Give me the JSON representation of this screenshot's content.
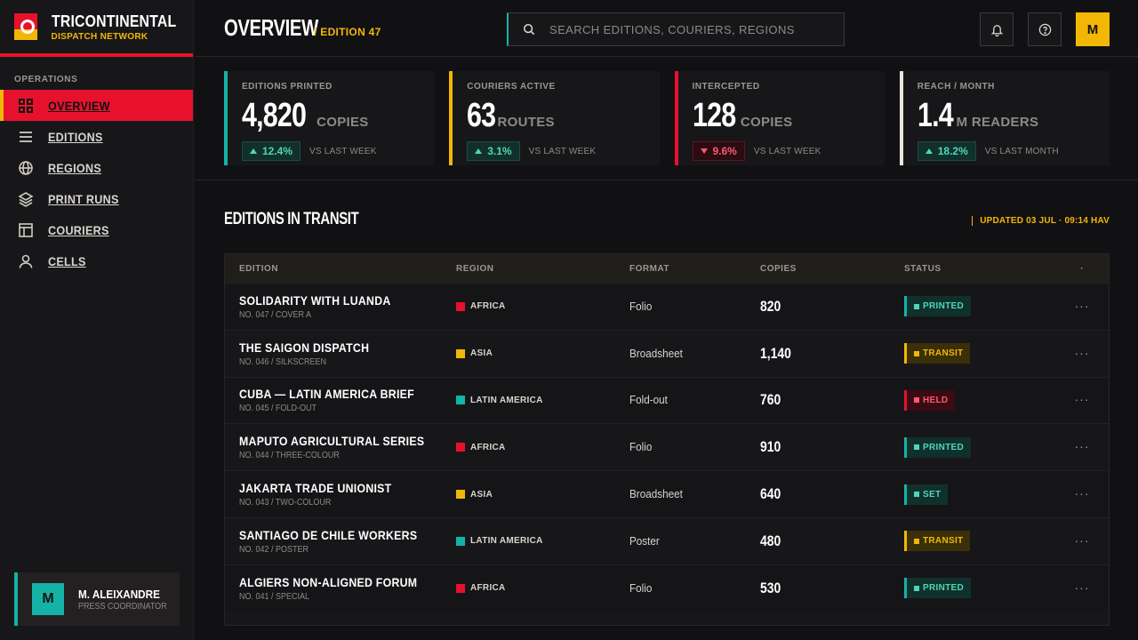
{
  "brand": {
    "title": "TRICONTINENTAL",
    "subtitle": "DISPATCH NETWORK"
  },
  "sidebar": {
    "section": "OPERATIONS",
    "items": [
      {
        "label": "Overview",
        "icon": "grid-icon"
      },
      {
        "label": "Editions",
        "icon": "list-icon"
      },
      {
        "label": "Regions",
        "icon": "globe-icon"
      },
      {
        "label": "Print Runs",
        "icon": "layers-icon"
      },
      {
        "label": "Couriers",
        "icon": "layout-icon"
      },
      {
        "label": "Cells",
        "icon": "user-icon"
      }
    ],
    "active_index": 0
  },
  "user": {
    "initial": "M",
    "name": "M. ALEIXANDRE",
    "role": "PRESS COORDINATOR"
  },
  "header": {
    "title": "OVERVIEW",
    "edition": "/ EDITION 47",
    "search_placeholder": "Search editions, couriers, regions",
    "avatar_initial": "M"
  },
  "kpis": [
    {
      "label": "Editions Printed",
      "value": "4,820",
      "unit": "copies",
      "delta": "12.4%",
      "direction": "up",
      "compare": "vs last week"
    },
    {
      "label": "Couriers Active",
      "value": "63",
      "unit": "routes",
      "delta": "3.1%",
      "direction": "up",
      "compare": "vs last week"
    },
    {
      "label": "Intercepted",
      "value": "128",
      "unit": "copies",
      "delta": "9.6%",
      "direction": "down",
      "compare": "vs last week"
    },
    {
      "label": "Reach / Month",
      "value": "1.4",
      "unit": "M readers",
      "delta": "18.2%",
      "direction": "up",
      "compare": "vs last month"
    }
  ],
  "section": {
    "title": "EDITIONS IN TRANSIT",
    "updated": "UPDATED 03 JUL · 09:14 HAV"
  },
  "table": {
    "columns": [
      "Edition",
      "Region",
      "Format",
      "Copies",
      "Status",
      "·"
    ],
    "rows": [
      {
        "title": "Solidarity with Luanda",
        "sub": "No. 047 / Cover A",
        "region": "Africa",
        "region_color": "#e8112d",
        "format": "Folio",
        "copies": "820",
        "status": "Printed",
        "status_kind": "printed"
      },
      {
        "title": "The Saigon Dispatch",
        "sub": "No. 046 / Silkscreen",
        "region": "Asia",
        "region_color": "#f2b705",
        "format": "Broadsheet",
        "copies": "1,140",
        "status": "Transit",
        "status_kind": "transit"
      },
      {
        "title": "Cuba — Latin America Brief",
        "sub": "No. 045 / Fold-out",
        "region": "Latin America",
        "region_color": "#15b2a8",
        "format": "Fold-out",
        "copies": "760",
        "status": "Held",
        "status_kind": "held"
      },
      {
        "title": "Maputo Agricultural Series",
        "sub": "No. 044 / Three-colour",
        "region": "Africa",
        "region_color": "#e8112d",
        "format": "Folio",
        "copies": "910",
        "status": "Printed",
        "status_kind": "printed"
      },
      {
        "title": "Jakarta Trade Unionist",
        "sub": "No. 043 / Two-colour",
        "region": "Asia",
        "region_color": "#f2b705",
        "format": "Broadsheet",
        "copies": "640",
        "status": "Set",
        "status_kind": "set"
      },
      {
        "title": "Santiago de Chile Workers",
        "sub": "No. 042 / Poster",
        "region": "Latin America",
        "region_color": "#15b2a8",
        "format": "Poster",
        "copies": "480",
        "status": "Transit",
        "status_kind": "transit"
      },
      {
        "title": "Algiers Non-Aligned Forum",
        "sub": "No. 041 / Special",
        "region": "Africa",
        "region_color": "#e8112d",
        "format": "Folio",
        "copies": "530",
        "status": "Printed",
        "status_kind": "printed"
      }
    ]
  },
  "colors": {
    "red": "#e8112d",
    "yellow": "#f2b705",
    "teal": "#15b2a8",
    "bg": "#111114"
  }
}
